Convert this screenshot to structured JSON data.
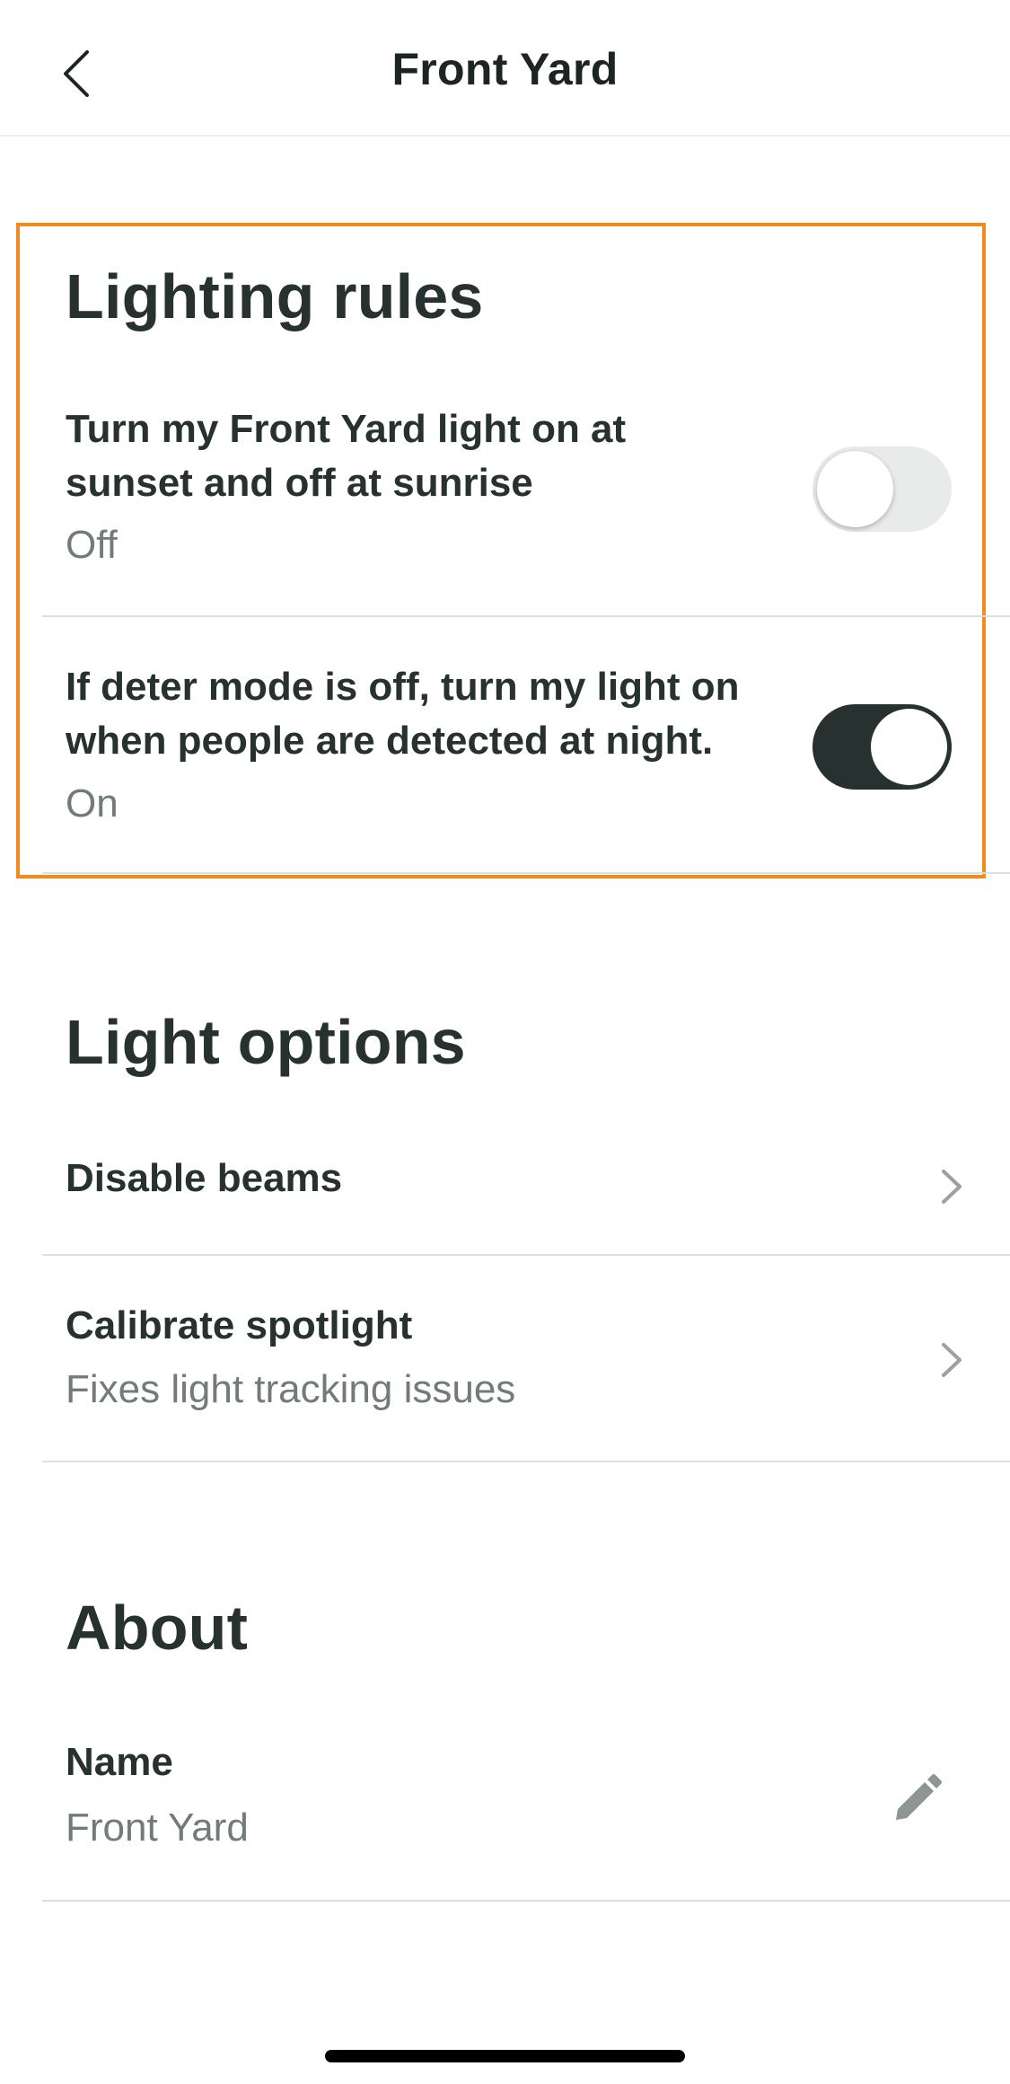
{
  "header": {
    "title": "Front Yard",
    "back_icon": "chevron-left-icon"
  },
  "lighting_rules": {
    "section_title": "Lighting rules",
    "highlight_color": "#f38a1c",
    "rules": [
      {
        "title_line1": "Turn my Front Yard light on at",
        "title_line2": "sunset and off at sunrise",
        "status": "Off",
        "enabled": false
      },
      {
        "title_line1": "If deter mode is off, turn my light on",
        "title_line2": "when people are detected at night.",
        "status": "On",
        "enabled": true
      }
    ]
  },
  "light_options": {
    "section_title": "Light options",
    "items": [
      {
        "title": "Disable beams",
        "icon": "chevron-right-icon"
      },
      {
        "title": "Calibrate spotlight",
        "subtitle": "Fixes light tracking issues",
        "icon": "chevron-right-icon"
      }
    ]
  },
  "about": {
    "section_title": "About",
    "name_label": "Name",
    "name_value": "Front Yard",
    "edit_icon": "pencil-icon"
  },
  "colors": {
    "text_primary": "#263130",
    "text_secondary": "#727b79",
    "toggle_on": "#263130",
    "toggle_off": "#e9eaea",
    "accent_highlight": "#f38a1c"
  }
}
